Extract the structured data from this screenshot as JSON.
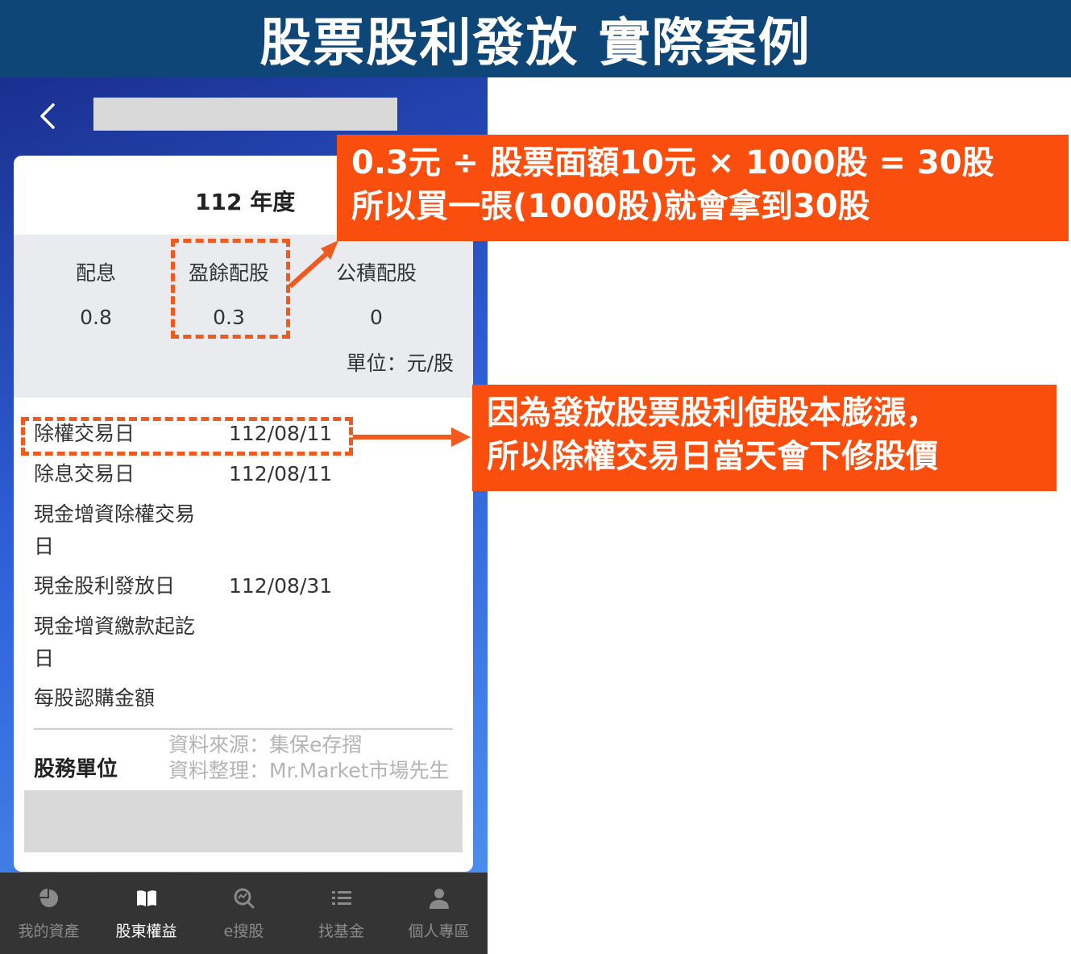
{
  "banner": {
    "title": "股票股利發放 實際案例"
  },
  "app": {
    "back_icon": "chevron-left-icon",
    "year_label": "112 年度",
    "dividends": [
      {
        "label": "配息",
        "value": "0.8"
      },
      {
        "label": "盈餘配股",
        "value": "0.3"
      },
      {
        "label": "公積配股",
        "value": "0"
      }
    ],
    "unit": "單位：元/股",
    "rows": [
      {
        "key": "除權交易日",
        "value": "112/08/11"
      },
      {
        "key": "除息交易日",
        "value": "112/08/11"
      },
      {
        "key": "現金增資除權交易日",
        "value": ""
      },
      {
        "key": "現金股利發放日",
        "value": "112/08/31"
      },
      {
        "key": "現金增資繳款起訖日",
        "value": ""
      },
      {
        "key": "每股認購金額",
        "value": ""
      }
    ],
    "agent_label": "股務單位",
    "source_line1": "資料來源：集保e存摺",
    "source_line2": "資料整理：Mr.Market市場先生"
  },
  "nav": [
    {
      "label": "我的資產",
      "icon": "pie-chart-icon",
      "active": false
    },
    {
      "label": "股東權益",
      "icon": "book-icon",
      "active": true
    },
    {
      "label": "e搜股",
      "icon": "search-chart-icon",
      "active": false
    },
    {
      "label": "找基金",
      "icon": "list-icon",
      "active": false
    },
    {
      "label": "個人專區",
      "icon": "person-icon",
      "active": false
    }
  ],
  "callouts": {
    "stock_dividend_line1": "0.3元 ÷ 股票面額10元 × 1000股 = 30股",
    "stock_dividend_line2": "所以買一張(1000股)就會拿到30股",
    "ex_rights_line1": "因為發放股票股利使股本膨漲，",
    "ex_rights_line2": "所以除權交易日當天會下修股價"
  },
  "colors": {
    "banner": "#0d4677",
    "accent": "#fa4e0e",
    "nav_bg": "#343434"
  }
}
